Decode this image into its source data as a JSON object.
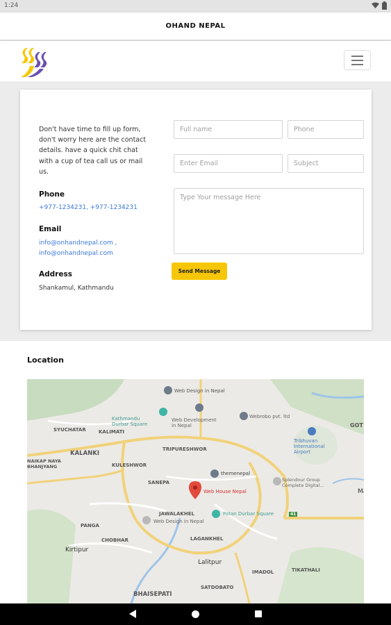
{
  "status_bar": {
    "time": "1:24"
  },
  "app_bar": {
    "title": "OHAND NEPAL"
  },
  "contact": {
    "intro": "Don't have time to fill up form, don't worry here are the contact details. have a quick chit chat with a cup of tea call us or mail us.",
    "phone_label": "Phone",
    "phone_value": "+977-1234231, +977-1234231",
    "email_label": "Email",
    "email_value_1": "info@onhandnepal.com ,",
    "email_value_2": "info@onhandnepal.com",
    "address_label": "Address",
    "address_value": "Shankamul, Kathmandu"
  },
  "form": {
    "fullname_placeholder": "Full name",
    "phone_placeholder": "Phone",
    "email_placeholder": "Enter Email",
    "subject_placeholder": "Subject",
    "message_placeholder": "Type Your message Here",
    "send_label": "Send Message"
  },
  "location": {
    "title": "Location",
    "map_labels": {
      "kathmandu_durbar": "Kathmandu\nDurbar Square",
      "web_design": "Web Design in Nepal",
      "web_dev": "Web Development\nin Nepal",
      "webrobo": "Webrobo pvt. ltd",
      "airport": "Tribhuvan\nInternational\nAirport",
      "syuchatar": "SYUCHATAR",
      "kalimati": "KALIMATI",
      "kalanki": "KALANKI",
      "naikap": "NAIKAP NAYA\nBHANJYANG",
      "kuleshwor": "KULESHWOR",
      "tripureshwor": "TRIPURESHWOR",
      "themenepal": "themenepal",
      "splendour": "Splendour Group\nComplete Digital...",
      "sanepa": "SANEPA",
      "web_house": "Web House Nepal",
      "jawalakhel": "JAWALAKHEL",
      "web_design_2": "Web Design in Nepal",
      "patan": "Patan Durbar Square",
      "panga": "PANGA",
      "chobhar": "CHOBHAR",
      "kirtipur": "Kirtipur",
      "lagankhel": "LAGANKHEL",
      "lalitpur": "Lalitpur",
      "imadol": "IMADOL",
      "tikathali": "TIKATHALI",
      "bhaisepati": "BHAISEPATI",
      "satdobato": "SATDOBATO",
      "got": "GOT",
      "ma": "Ma",
      "road_41": "41"
    }
  },
  "icons": {
    "wifi": "wifi-icon",
    "battery": "battery-icon",
    "menu": "hamburger-menu-icon",
    "back": "back-icon",
    "home": "home-icon",
    "recent": "recent-apps-icon"
  }
}
